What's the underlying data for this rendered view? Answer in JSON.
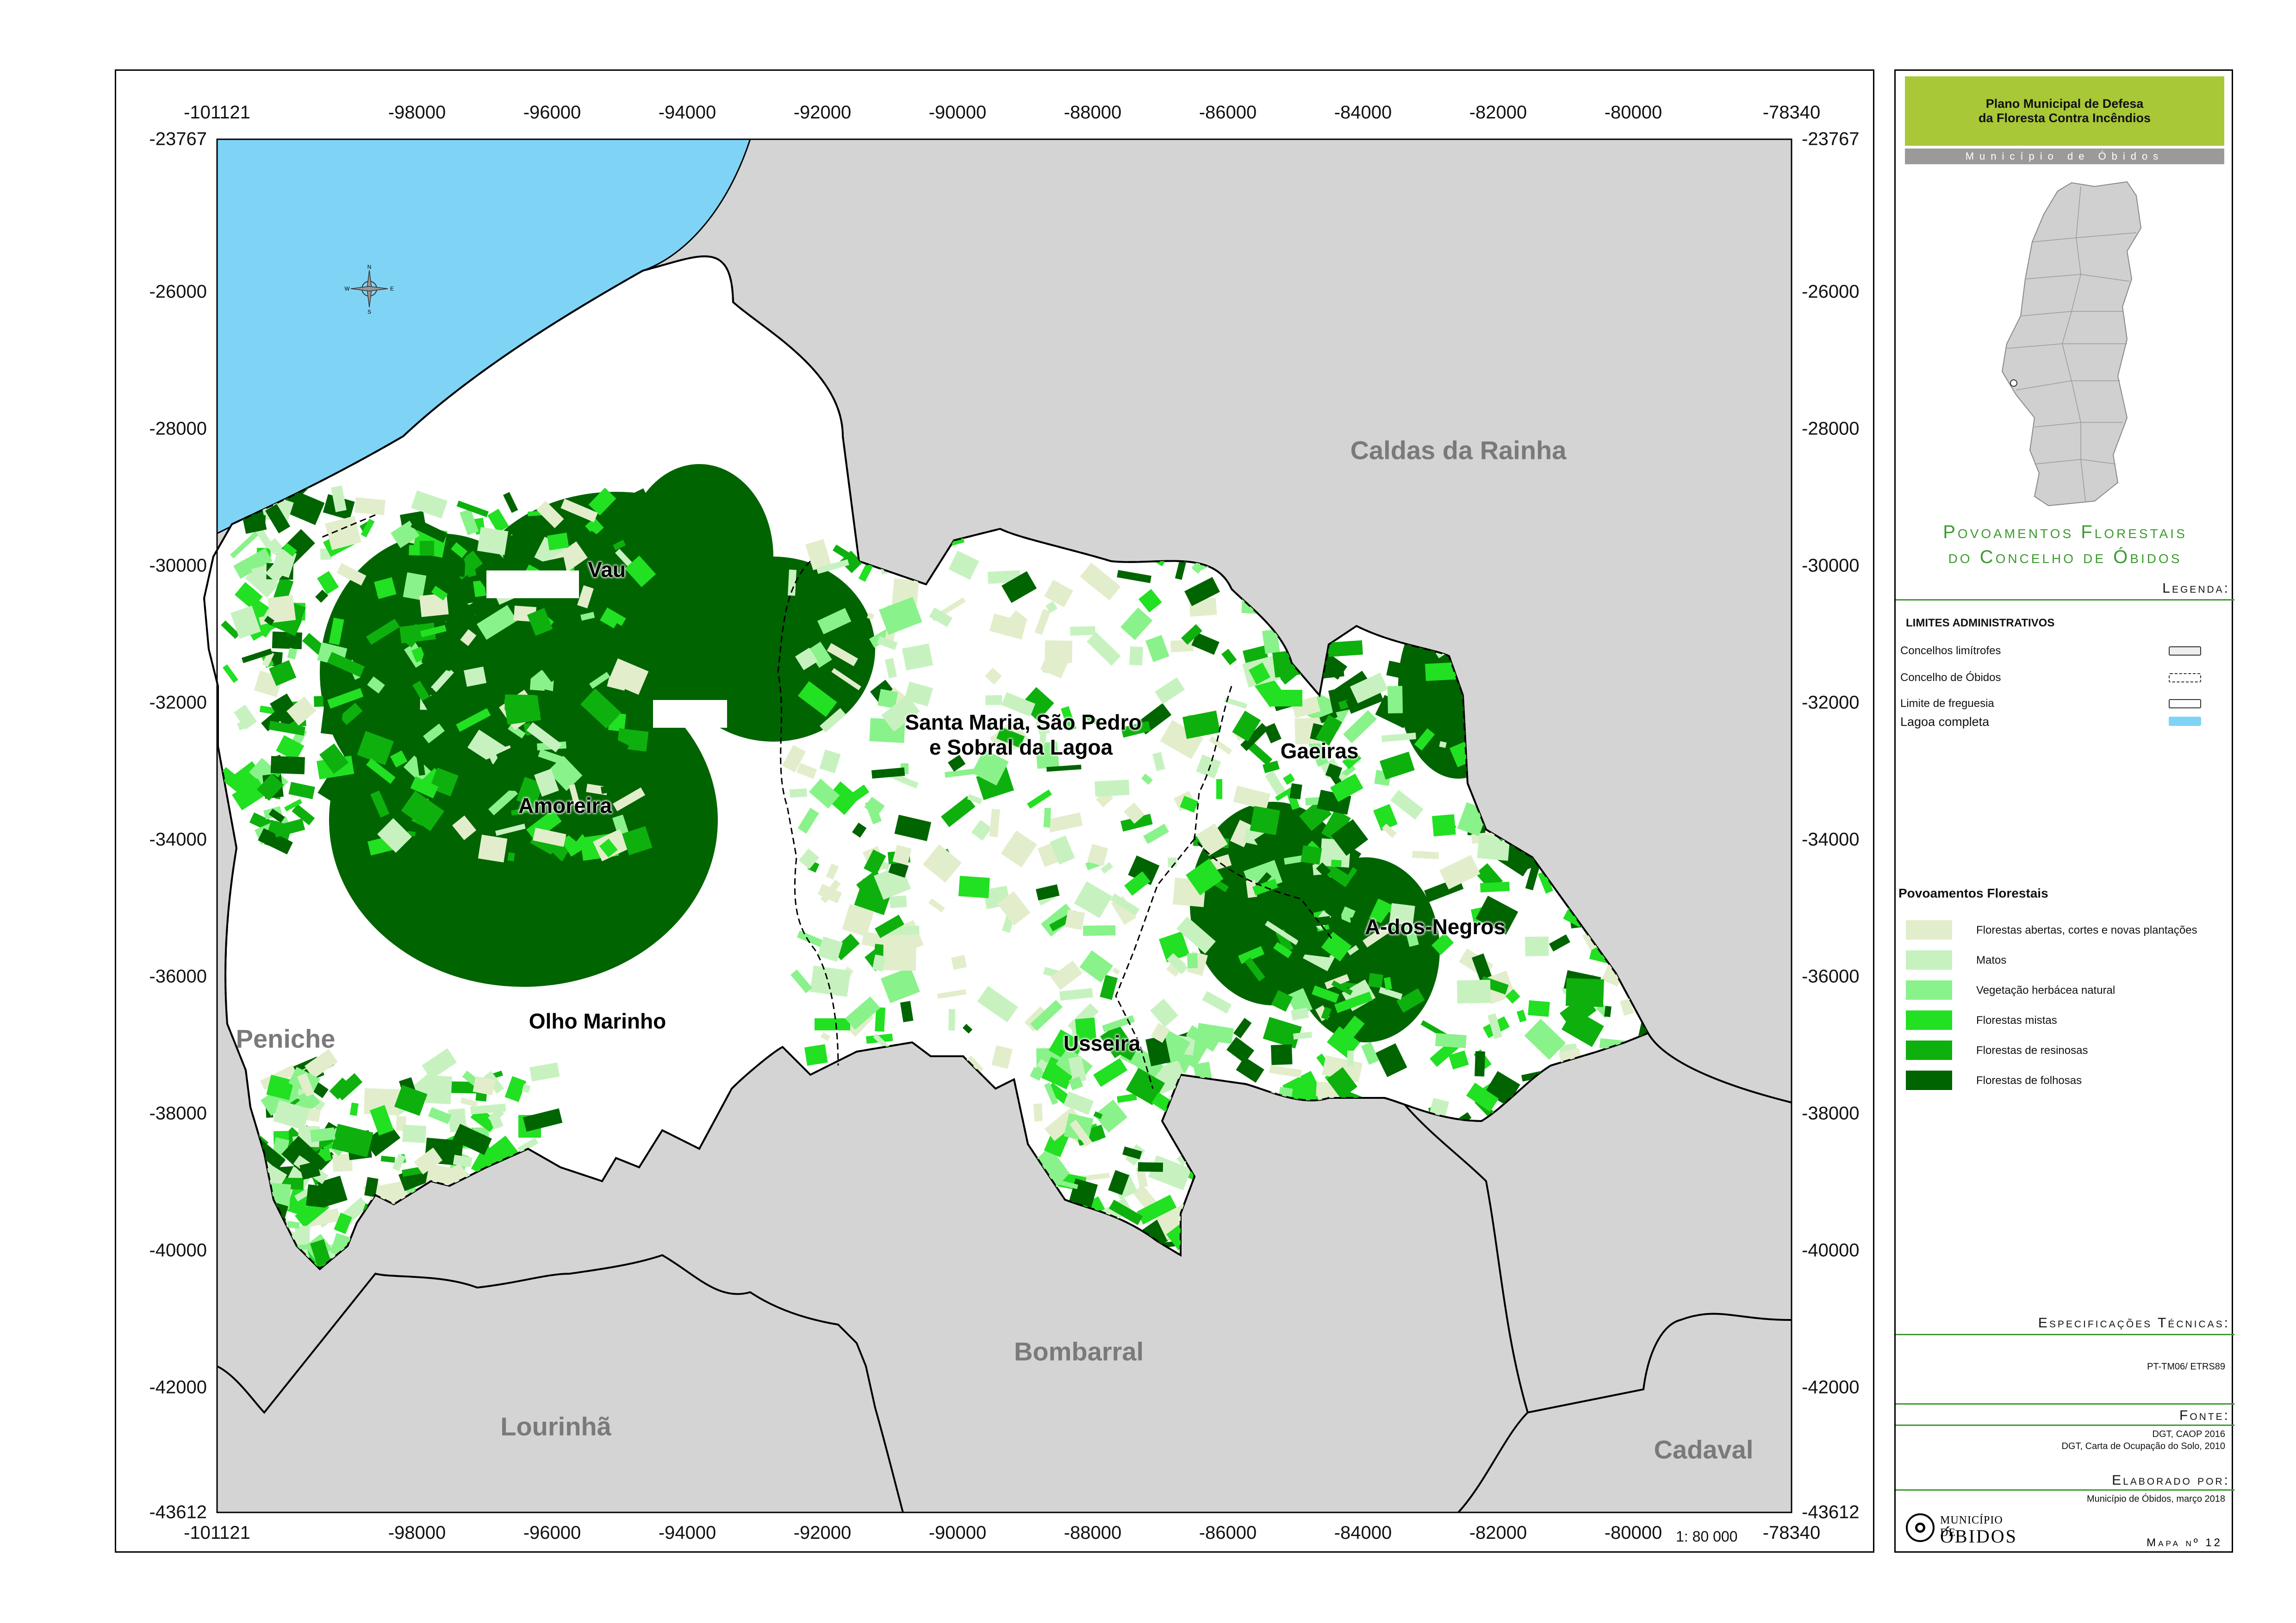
{
  "map": {
    "x_ticks": [
      "-101121",
      "-98000",
      "-96000",
      "-94000",
      "-92000",
      "-90000",
      "-88000",
      "-86000",
      "-84000",
      "-82000",
      "-80000",
      "-78340"
    ],
    "y_ticks": [
      "-23767",
      "-26000",
      "-28000",
      "-30000",
      "-32000",
      "-34000",
      "-36000",
      "-38000",
      "-40000",
      "-42000",
      "-43612"
    ],
    "neighbours": [
      "Caldas da Rainha",
      "Peniche",
      "Bombarral",
      "Lourinhã",
      "Cadaval"
    ],
    "parishes": [
      "Vau",
      "Amoreira",
      "Olho Marinho",
      "Santa Maria, São Pedro",
      "e Sobral da Lagoa",
      "Gaeiras",
      "A-dos-Negros",
      "Usseira"
    ],
    "scale": "1: 80 000",
    "compass": {
      "n": "N",
      "s": "S",
      "e": "E",
      "w": "W"
    },
    "colors": {
      "land": "#d4d4d4",
      "lagoon": "#7fd4f6",
      "municipality": "#ffffff"
    }
  },
  "panel": {
    "title_line1": "Plano Municipal de Defesa",
    "title_line2": "da Floresta Contra Incêndios",
    "municipio": "Município de Óbidos",
    "map_title_line1": "Povoamentos Florestais",
    "map_title_line2": "do Concelho de Óbidos",
    "legend_heading": "Legenda:",
    "admin_heading": "LIMITES ADMINISTRATIVOS",
    "admin_items": [
      {
        "label": "Concelhos limítrofes"
      },
      {
        "label": "Concelho de Óbidos"
      },
      {
        "label": "Limite de freguesia"
      },
      {
        "label": "Lagoa completa"
      }
    ],
    "forest_heading": "Povoamentos Florestais",
    "forest_items": [
      {
        "label": "Florestas abertas, cortes e novas plantações",
        "color": "#e2eecb"
      },
      {
        "label": "Matos",
        "color": "#c7f2c0"
      },
      {
        "label": "Vegetação herbácea natural",
        "color": "#8af28a"
      },
      {
        "label": "Florestas mistas",
        "color": "#22e022"
      },
      {
        "label": "Florestas de resinosas",
        "color": "#0eb00e"
      },
      {
        "label": "Florestas de folhosas",
        "color": "#006400"
      }
    ],
    "spec_heading": "Especificações Técnicas:",
    "spec_value": "PT-TM06/ ETRS89",
    "source_heading": "Fonte:",
    "source_line1": "DGT, CAOP 2016",
    "source_line2": "DGT, Carta de Ocupação do Solo, 2010",
    "author_heading": "Elaborado por:",
    "author_value": "Município de Óbidos, março 2018",
    "logo_top": "MUNICÍPIO DE",
    "logo_bottom": "ÓBIDOS",
    "map_number": "Mapa nº 12"
  }
}
